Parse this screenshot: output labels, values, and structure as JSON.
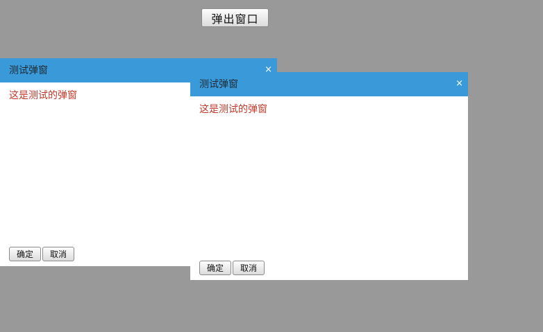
{
  "page": {
    "open_button_label": "弹出窗口",
    "background_color": "#999999"
  },
  "dialogs": [
    {
      "title": "测试弹窗",
      "close_label": "×",
      "message": "这是测试的弹窗",
      "ok_label": "确定",
      "cancel_label": "取消"
    },
    {
      "title": "测试弹窗",
      "close_label": "×",
      "message": "这是测试的弹窗",
      "ok_label": "确定",
      "cancel_label": "取消"
    }
  ],
  "colors": {
    "header": "#3a99d9",
    "message": "#c0392b"
  }
}
